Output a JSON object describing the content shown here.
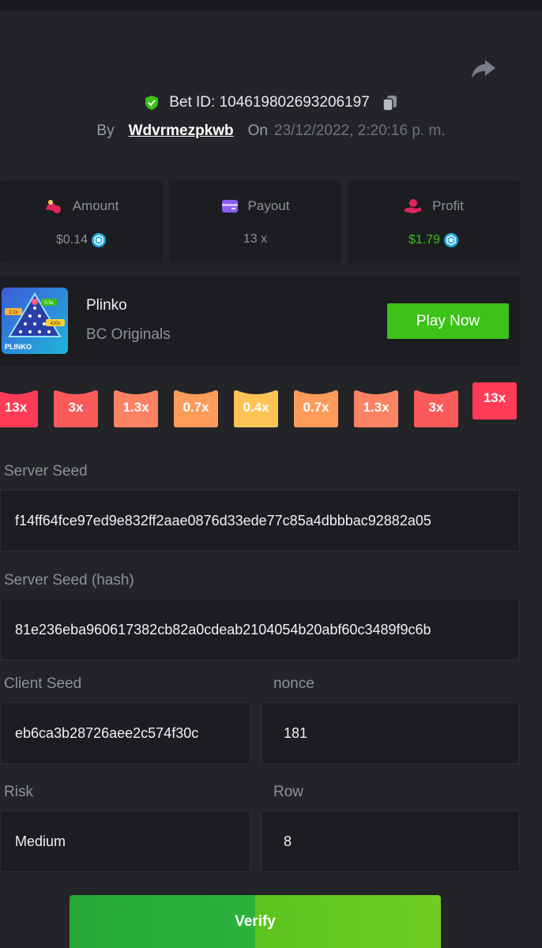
{
  "bet": {
    "id_text": "Bet ID: 104619802693206197",
    "by_label": "By",
    "username": "Wdvrmezpkwb",
    "on_label": "On",
    "date": "23/12/2022, 2:20:16 p. m."
  },
  "stats": {
    "amount": {
      "label": "Amount",
      "value": "$0.14",
      "icon": "bag-coins-icon",
      "color": "#e0245e"
    },
    "payout": {
      "label": "Payout",
      "value": "13 x",
      "icon": "wallet-icon",
      "color": "#8b5cf6"
    },
    "profit": {
      "label": "Profit",
      "value": "$1.79",
      "icon": "hand-coin-icon",
      "color": "#3bc117"
    }
  },
  "game": {
    "name": "Plinko",
    "provider": "BC Originals",
    "play_label": "Play Now",
    "thumb_caption": "PLINKO",
    "thumb_tags": [
      "2.1x",
      "0.5x",
      "420x"
    ]
  },
  "multipliers": [
    {
      "label": "13x",
      "color": "#ff3c57"
    },
    {
      "label": "3x",
      "color": "#fb5a5a"
    },
    {
      "label": "1.3x",
      "color": "#fb8263"
    },
    {
      "label": "0.7x",
      "color": "#fd9c5a"
    },
    {
      "label": "0.4x",
      "color": "#ffc455"
    },
    {
      "label": "0.7x",
      "color": "#fd9c5a"
    },
    {
      "label": "1.3x",
      "color": "#fb8263"
    },
    {
      "label": "3x",
      "color": "#fb5a5a"
    },
    {
      "label": "13x",
      "color": "#ff3c57"
    }
  ],
  "fields": {
    "server_seed": {
      "label": "Server Seed",
      "value": "f14ff64fce97ed9e832ff2aae0876d33ede77c85a4dbbbac92882a05"
    },
    "server_seed_hash": {
      "label": "Server Seed (hash)",
      "value": "81e236eba960617382cb82a0cdeab2104054b20abf60c3489f9c6b"
    },
    "client_seed": {
      "label": "Client Seed",
      "value": "eb6ca3b28726aee2c574f30c"
    },
    "nonce": {
      "label": "nonce",
      "value": "181"
    },
    "risk": {
      "label": "Risk",
      "value": "Medium"
    },
    "row": {
      "label": "Row",
      "value": "8"
    }
  },
  "verify_label": "Verify"
}
